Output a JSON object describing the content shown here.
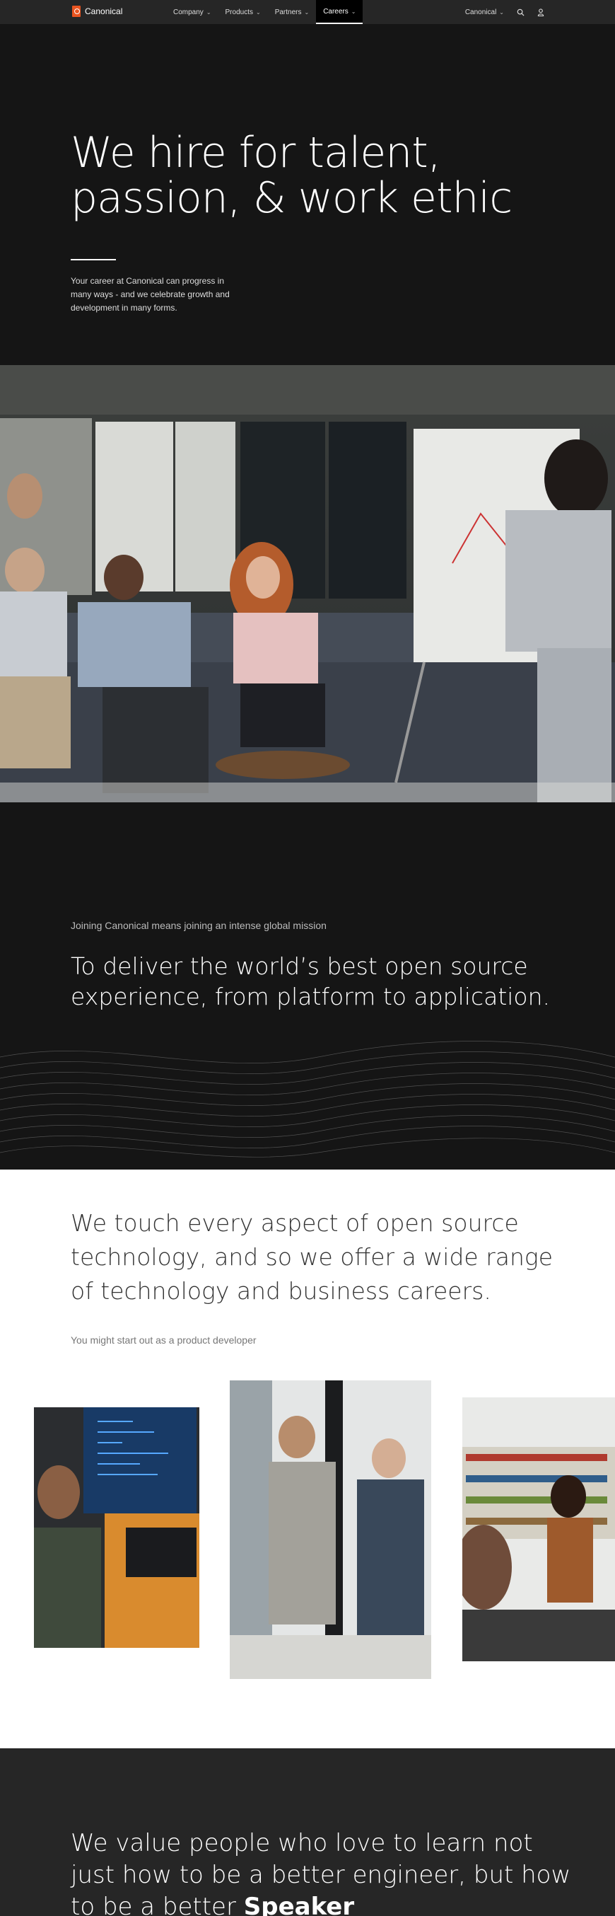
{
  "nav": {
    "brand": "Canonical",
    "items": [
      {
        "label": "Company"
      },
      {
        "label": "Products"
      },
      {
        "label": "Partners"
      },
      {
        "label": "Careers"
      }
    ],
    "account_label": "Canonical",
    "icons": [
      "chevron-down-icon",
      "search-icon",
      "user-icon"
    ]
  },
  "hero": {
    "title": "We hire for talent, passion, & work ethic",
    "description": "Your career at Canonical can progress in many ways - and we celebrate growth and development in many forms."
  },
  "mission": {
    "kicker": "Joining Canonical means joining an intense global mission",
    "title": "To deliver the world’s best open source experience, from platform to application."
  },
  "careers": {
    "title": "We touch every aspect of open source technology, and so we offer a wide range of technology and business careers.",
    "subtitle": "You might start out as a product developer"
  },
  "values": {
    "title_prefix": "We value people who love to learn not just how to be a better engineer, but how to be a better ",
    "title_highlight": "Speaker"
  },
  "colors": {
    "accent": "#e95420",
    "dark_bg": "#151515",
    "nav_bg": "#262626"
  }
}
